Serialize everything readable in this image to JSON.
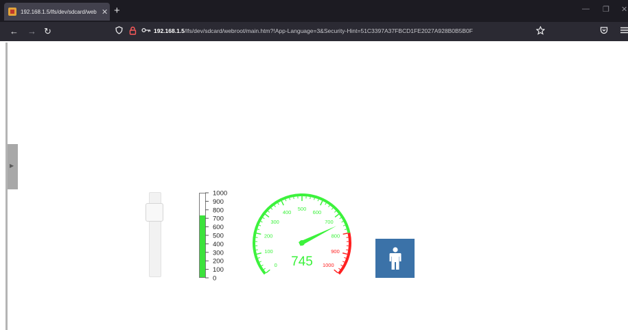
{
  "browser": {
    "tab_title": "192.168.1.5/lfs/dev/sdcard/web ",
    "tab_close": "✕",
    "new_tab": "+",
    "url_host": "192.168.1.5",
    "url_rest": "/lfs/dev/sdcard/webroot/main.htm?!App-Language=3&Security-Hint=51C3397A37FBCD1FE2027A928B0B5B0F",
    "window_controls": [
      "—",
      "❐",
      "✕"
    ],
    "icons": [
      "back-icon",
      "forward-icon",
      "reload-icon",
      "shield-icon",
      "lock-icon",
      "key-icon",
      "bookmark-star-icon",
      "pocket-icon",
      "menu-icon"
    ]
  },
  "widgets": {
    "slider": {
      "value_fraction": 0.87
    },
    "bar_gauge": {
      "value": 740,
      "min": 0,
      "max": 1000,
      "fill_color": "#3ce23c",
      "ticks": [
        "1000",
        "900",
        "800",
        "700",
        "600",
        "500",
        "400",
        "300",
        "200",
        "100",
        "0"
      ]
    },
    "dial_gauge": {
      "value": 745,
      "value_text": "745",
      "min": 0,
      "max": 1000,
      "green": "#3cf23c",
      "red": "#ff2020",
      "red_from": 800,
      "labels": [
        "0",
        "100",
        "200",
        "300",
        "400",
        "500",
        "600",
        "700",
        "800",
        "900",
        "1000"
      ]
    },
    "person_tile": {
      "icon": "person-icon",
      "color": "#3b72a8"
    }
  }
}
